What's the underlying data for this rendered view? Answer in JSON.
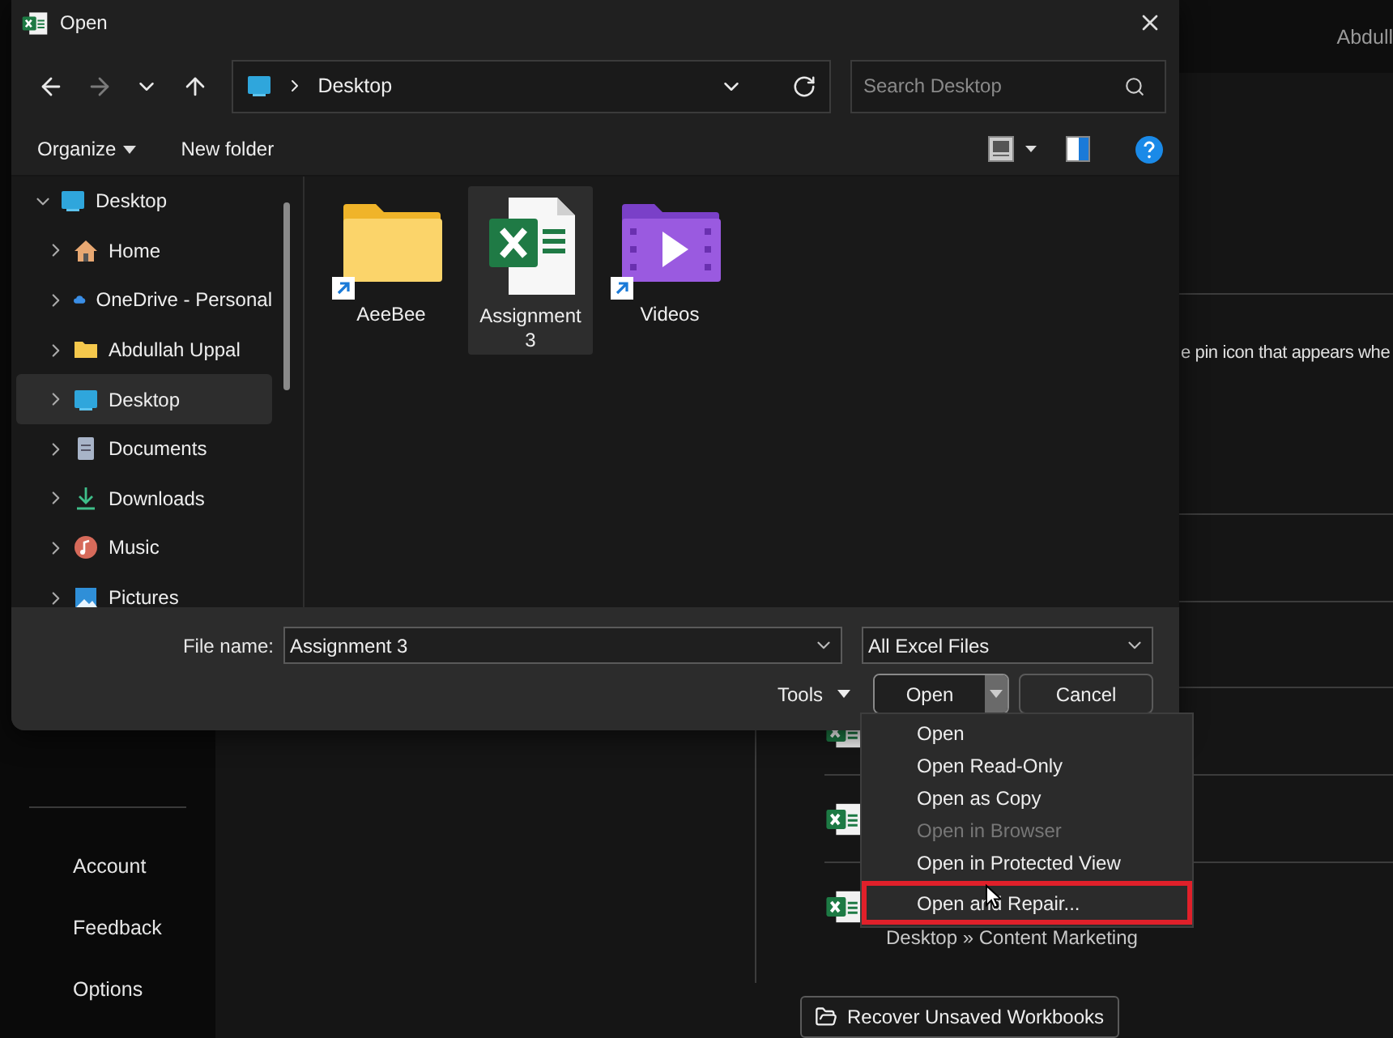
{
  "backstage": {
    "user": "Abdull",
    "hint": "e pin icon that appears whe",
    "sidebar": [
      "Account",
      "Feedback",
      "Options"
    ],
    "recent": [
      {
        "kind": "workbook"
      },
      {
        "kind": "workbook"
      },
      {
        "kind": "workbook",
        "location": "Desktop » Content Marketing"
      }
    ],
    "recover_button": "Recover Unsaved Workbooks"
  },
  "dialog": {
    "title": "Open",
    "address": "Desktop",
    "search": {
      "placeholder": "Search Desktop"
    },
    "toolbar": {
      "organize": "Organize",
      "new_folder": "New folder"
    },
    "tree": [
      {
        "label": "Desktop",
        "kind": "desktop",
        "expanded": true,
        "selected": false,
        "children": [
          {
            "label": "Home",
            "kind": "home",
            "expanded": false,
            "selected": false
          },
          {
            "label": "OneDrive - Personal",
            "kind": "cloud",
            "expanded": false,
            "selected": false
          },
          {
            "label": "Abdullah Uppal",
            "kind": "folder",
            "expanded": false,
            "selected": false
          },
          {
            "label": "Desktop",
            "kind": "desktop",
            "expanded": false,
            "selected": true
          },
          {
            "label": "Documents",
            "kind": "documents",
            "expanded": false,
            "selected": false
          },
          {
            "label": "Downloads",
            "kind": "downloads",
            "expanded": false,
            "selected": false
          },
          {
            "label": "Music",
            "kind": "music",
            "expanded": false,
            "selected": false
          },
          {
            "label": "Pictures",
            "kind": "pictures",
            "expanded": false,
            "selected": false
          }
        ]
      }
    ],
    "files": [
      {
        "name": "AeeBee",
        "kind": "folder",
        "shortcut": true,
        "selected": false
      },
      {
        "name": "Assignment 3",
        "kind": "workbook",
        "shortcut": false,
        "selected": true
      },
      {
        "name": "Videos",
        "kind": "video",
        "shortcut": true,
        "selected": false
      }
    ],
    "file_name": {
      "label": "File name:",
      "value": "Assignment 3"
    },
    "file_type": "All Excel Files",
    "tools": "Tools",
    "open": "Open",
    "cancel": "Cancel"
  },
  "open_menu": [
    {
      "label": "Open",
      "disabled": false,
      "highlighted": false
    },
    {
      "label": "Open Read-Only",
      "disabled": false,
      "highlighted": false
    },
    {
      "label": "Open as Copy",
      "disabled": false,
      "highlighted": false
    },
    {
      "label": "Open in Browser",
      "disabled": true,
      "highlighted": false
    },
    {
      "label": "Open in Protected View",
      "disabled": false,
      "highlighted": false
    },
    {
      "label": "Open and Repair...",
      "disabled": false,
      "highlighted": true
    }
  ]
}
